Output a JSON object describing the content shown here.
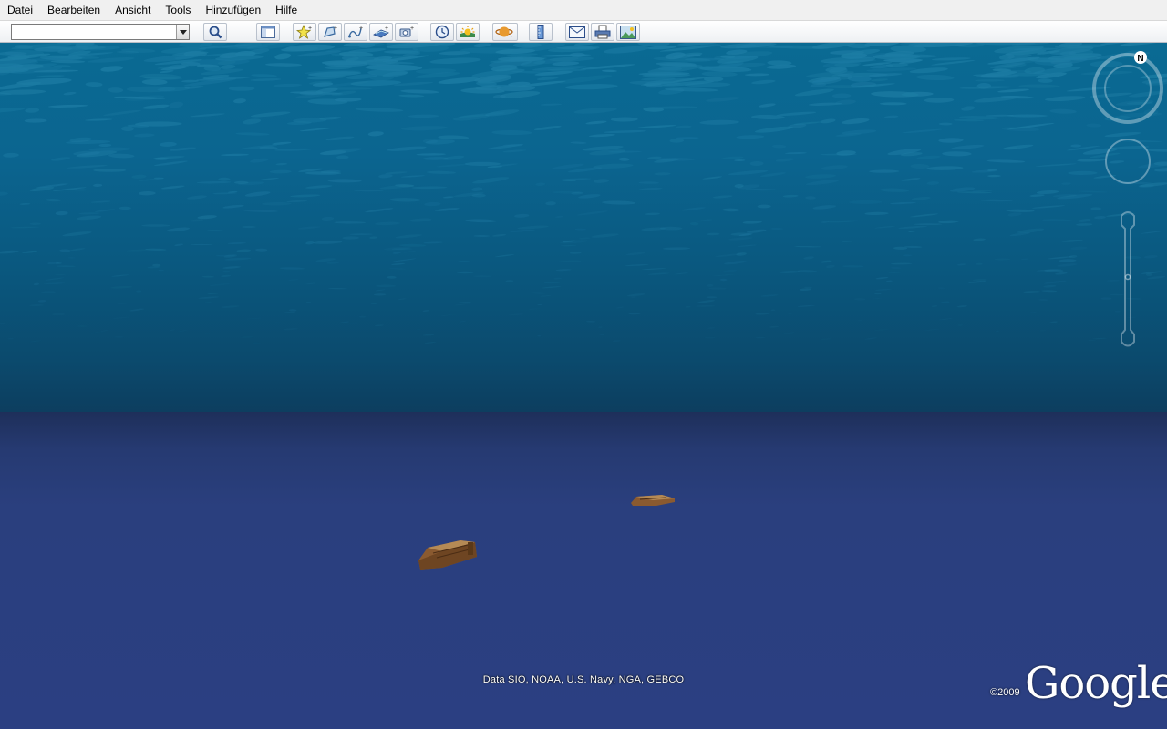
{
  "menu": {
    "items": [
      "Datei",
      "Bearbeiten",
      "Ansicht",
      "Tools",
      "Hinzufügen",
      "Hilfe"
    ]
  },
  "toolbar": {
    "search_value": "",
    "buttons": [
      {
        "name": "search-button",
        "icon": "magnifier-icon"
      },
      {
        "name": "sidebar-toggle-button",
        "icon": "sidebar-icon"
      },
      {
        "name": "add-placemark-button",
        "icon": "pushpin-icon"
      },
      {
        "name": "add-polygon-button",
        "icon": "polygon-icon"
      },
      {
        "name": "add-path-button",
        "icon": "path-icon"
      },
      {
        "name": "add-image-overlay-button",
        "icon": "image-overlay-icon"
      },
      {
        "name": "record-tour-button",
        "icon": "record-tour-icon"
      },
      {
        "name": "historical-imagery-button",
        "icon": "clock-icon"
      },
      {
        "name": "sunlight-button",
        "icon": "sun-icon"
      },
      {
        "name": "switch-planet-button",
        "icon": "planet-icon"
      },
      {
        "name": "ruler-button",
        "icon": "ruler-icon"
      },
      {
        "name": "email-button",
        "icon": "envelope-icon"
      },
      {
        "name": "print-button",
        "icon": "printer-icon"
      },
      {
        "name": "view-in-maps-button",
        "icon": "map-image-icon"
      }
    ]
  },
  "map": {
    "credits": "Data SIO, NOAA, U.S. Navy, NGA, GEBCO",
    "copyright": "©2009",
    "logo": "Google",
    "compass_label": "N",
    "colors": {
      "water_surface": "#0a6a93",
      "seafloor": "#2b3f82",
      "wreck": "#a07040"
    }
  }
}
